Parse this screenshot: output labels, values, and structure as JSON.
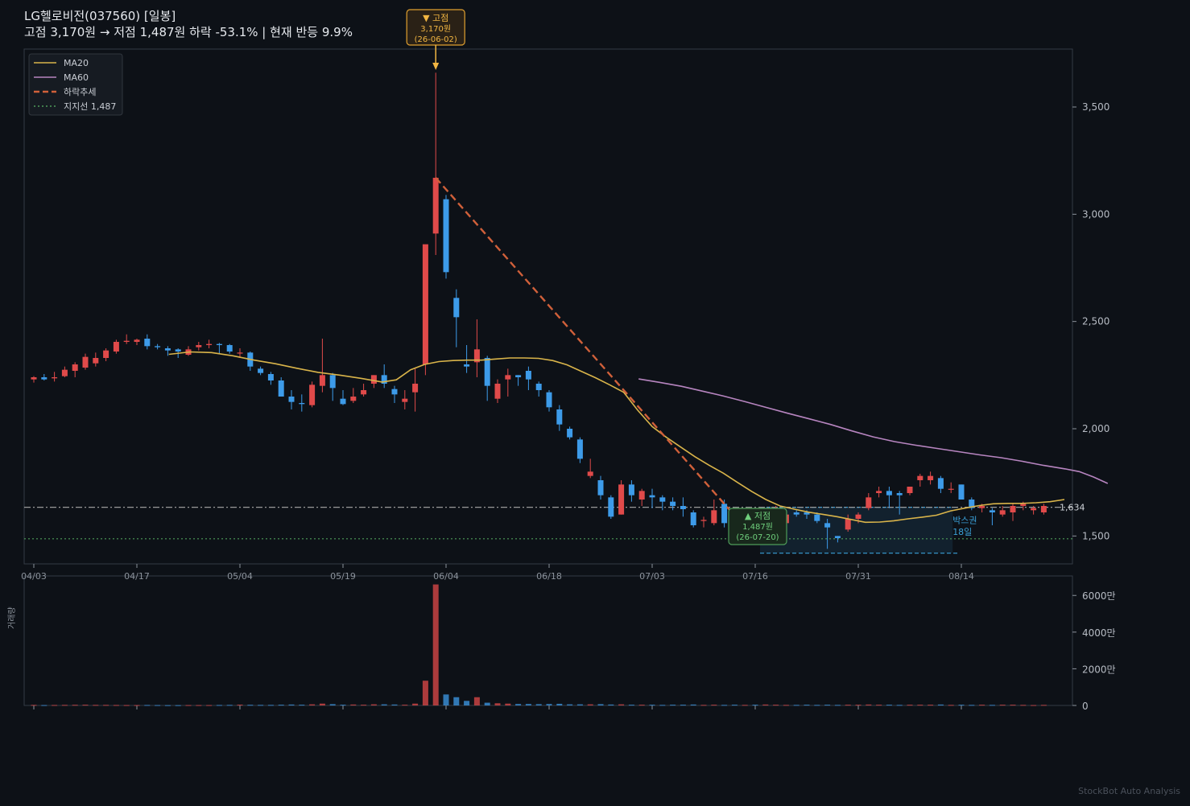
{
  "title": {
    "line1": "LG헬로비전(037560)  [일봉]",
    "line2": "고점 3,170원 → 저점 1,487원  하락 -53.1%  |  현재 반등 9.9%"
  },
  "watermark": "StockBot Auto Analysis",
  "colors": {
    "background": "#0d1117",
    "up": "#e04a4a",
    "down": "#3d9be9",
    "ma20": "#d9b44a",
    "ma60": "#b785c0",
    "trend": "#d0603a",
    "support": "#4e9d5a",
    "box": "#3aa0d8",
    "resistance": "#9a9a9a"
  },
  "chart_data": {
    "type": "candlestick",
    "xlabels": [
      "04/03",
      "04/17",
      "05/04",
      "05/19",
      "06/04",
      "06/18",
      "07/03",
      "07/16",
      "07/31",
      "08/14"
    ],
    "xlabel_indices": [
      0,
      10,
      20,
      30,
      40,
      50,
      60,
      70,
      80,
      90
    ],
    "ylim": [
      1370,
      3770
    ],
    "yticks": [
      1500,
      2000,
      2500,
      3000,
      3500
    ],
    "ytick_labels": [
      "1,500",
      "2,000",
      "2,500",
      "3,000",
      "3,500"
    ],
    "candles": [
      [
        2230,
        2245,
        2215,
        2240
      ],
      [
        2240,
        2255,
        2225,
        2230
      ],
      [
        2235,
        2265,
        2220,
        2240
      ],
      [
        2245,
        2290,
        2240,
        2275
      ],
      [
        2270,
        2310,
        2240,
        2300
      ],
      [
        2285,
        2350,
        2275,
        2335
      ],
      [
        2305,
        2355,
        2290,
        2330
      ],
      [
        2330,
        2375,
        2315,
        2365
      ],
      [
        2360,
        2415,
        2350,
        2405
      ],
      [
        2405,
        2440,
        2395,
        2410
      ],
      [
        2405,
        2420,
        2390,
        2415
      ],
      [
        2420,
        2440,
        2370,
        2385
      ],
      [
        2385,
        2395,
        2370,
        2380
      ],
      [
        2375,
        2385,
        2340,
        2365
      ],
      [
        2370,
        2375,
        2330,
        2360
      ],
      [
        2345,
        2385,
        2340,
        2370
      ],
      [
        2380,
        2405,
        2365,
        2390
      ],
      [
        2390,
        2415,
        2375,
        2395
      ],
      [
        2395,
        2400,
        2350,
        2390
      ],
      [
        2390,
        2395,
        2350,
        2360
      ],
      [
        2355,
        2375,
        2330,
        2355
      ],
      [
        2355,
        2360,
        2270,
        2290
      ],
      [
        2280,
        2290,
        2250,
        2260
      ],
      [
        2255,
        2265,
        2205,
        2225
      ],
      [
        2225,
        2240,
        2150,
        2150
      ],
      [
        2150,
        2180,
        2090,
        2125
      ],
      [
        2120,
        2160,
        2080,
        2115
      ],
      [
        2110,
        2220,
        2100,
        2205
      ],
      [
        2200,
        2420,
        2170,
        2250
      ],
      [
        2250,
        2260,
        2130,
        2190
      ],
      [
        2140,
        2180,
        2110,
        2115
      ],
      [
        2130,
        2190,
        2120,
        2150
      ],
      [
        2160,
        2210,
        2150,
        2180
      ],
      [
        2210,
        2250,
        2190,
        2250
      ],
      [
        2250,
        2300,
        2190,
        2210
      ],
      [
        2185,
        2200,
        2120,
        2160
      ],
      [
        2125,
        2180,
        2090,
        2140
      ],
      [
        2170,
        2280,
        2080,
        2210
      ],
      [
        2300,
        2500,
        2250,
        2860
      ],
      [
        2910,
        3660,
        2810,
        3170
      ],
      [
        3070,
        3090,
        2700,
        2730
      ],
      [
        2610,
        2650,
        2380,
        2520
      ],
      [
        2300,
        2390,
        2260,
        2290
      ],
      [
        2310,
        2510,
        2240,
        2370
      ],
      [
        2330,
        2340,
        2130,
        2200
      ],
      [
        2140,
        2230,
        2120,
        2210
      ],
      [
        2230,
        2280,
        2150,
        2250
      ],
      [
        2250,
        2250,
        2200,
        2240
      ],
      [
        2270,
        2290,
        2180,
        2230
      ],
      [
        2210,
        2220,
        2150,
        2180
      ],
      [
        2170,
        2180,
        2080,
        2100
      ],
      [
        2090,
        2110,
        1990,
        2020
      ],
      [
        2000,
        2010,
        1950,
        1960
      ],
      [
        1950,
        1960,
        1840,
        1860
      ],
      [
        1780,
        1860,
        1770,
        1800
      ],
      [
        1760,
        1780,
        1670,
        1690
      ],
      [
        1680,
        1690,
        1580,
        1590
      ],
      [
        1600,
        1760,
        1600,
        1740
      ],
      [
        1740,
        1760,
        1660,
        1690
      ],
      [
        1670,
        1720,
        1640,
        1710
      ],
      [
        1690,
        1720,
        1630,
        1680
      ],
      [
        1680,
        1690,
        1620,
        1660
      ],
      [
        1660,
        1680,
        1620,
        1640
      ],
      [
        1640,
        1680,
        1590,
        1625
      ],
      [
        1610,
        1620,
        1540,
        1550
      ],
      [
        1570,
        1590,
        1540,
        1575
      ],
      [
        1560,
        1670,
        1550,
        1620
      ],
      [
        1650,
        1670,
        1540,
        1560
      ],
      [
        1560,
        1580,
        1470,
        1520
      ],
      [
        1470,
        1560,
        1460,
        1520
      ],
      [
        1530,
        1550,
        1480,
        1490
      ],
      [
        1480,
        1600,
        1470,
        1590
      ],
      [
        1590,
        1640,
        1560,
        1620
      ],
      [
        1560,
        1600,
        1530,
        1600
      ],
      [
        1610,
        1620,
        1590,
        1600
      ],
      [
        1610,
        1620,
        1580,
        1600
      ],
      [
        1600,
        1610,
        1560,
        1570
      ],
      [
        1560,
        1580,
        1440,
        1540
      ],
      [
        1500,
        1500,
        1470,
        1490
      ],
      [
        1530,
        1600,
        1520,
        1580
      ],
      [
        1580,
        1610,
        1560,
        1600
      ],
      [
        1630,
        1700,
        1620,
        1680
      ],
      [
        1700,
        1730,
        1680,
        1710
      ],
      [
        1710,
        1730,
        1630,
        1690
      ],
      [
        1700,
        1710,
        1600,
        1690
      ],
      [
        1700,
        1730,
        1690,
        1730
      ],
      [
        1760,
        1790,
        1730,
        1780
      ],
      [
        1760,
        1800,
        1740,
        1780
      ],
      [
        1770,
        1780,
        1700,
        1720
      ],
      [
        1720,
        1750,
        1700,
        1720
      ],
      [
        1740,
        1740,
        1670,
        1670
      ],
      [
        1670,
        1680,
        1620,
        1630
      ],
      [
        1630,
        1650,
        1610,
        1640
      ],
      [
        1620,
        1630,
        1550,
        1610
      ],
      [
        1600,
        1640,
        1590,
        1620
      ],
      [
        1610,
        1650,
        1570,
        1640
      ],
      [
        1640,
        1660,
        1620,
        1650
      ],
      [
        1620,
        1640,
        1600,
        1630
      ],
      [
        1610,
        1650,
        1600,
        1640
      ]
    ],
    "ma20": [
      [
        19,
        2347
      ],
      [
        22,
        2358
      ],
      [
        25,
        2355
      ],
      [
        28,
        2340
      ],
      [
        31,
        2320
      ],
      [
        34,
        2303
      ],
      [
        37,
        2282
      ],
      [
        40,
        2263
      ],
      [
        43,
        2250
      ],
      [
        46,
        2235
      ],
      [
        49,
        2218
      ],
      [
        51,
        2228
      ],
      [
        53,
        2275
      ],
      [
        55,
        2300
      ],
      [
        57,
        2313
      ],
      [
        59,
        2318
      ],
      [
        61,
        2320
      ],
      [
        63,
        2320
      ],
      [
        65,
        2325
      ],
      [
        67,
        2330
      ],
      [
        69,
        2330
      ],
      [
        71,
        2328
      ],
      [
        73,
        2318
      ],
      [
        75,
        2298
      ],
      [
        77,
        2268
      ],
      [
        79,
        2238
      ],
      [
        81,
        2205
      ],
      [
        83,
        2170
      ],
      [
        85,
        2085
      ],
      [
        87,
        2010
      ],
      [
        89,
        1960
      ],
      [
        91,
        1915
      ],
      [
        93,
        1870
      ],
      [
        95,
        1830
      ],
      [
        97,
        1793
      ],
      [
        99,
        1750
      ],
      [
        101,
        1708
      ],
      [
        103,
        1670
      ],
      [
        105,
        1640
      ],
      [
        107,
        1625
      ],
      [
        109,
        1611
      ],
      [
        111,
        1601
      ],
      [
        113,
        1590
      ],
      [
        115,
        1577
      ],
      [
        117,
        1564
      ],
      [
        119,
        1565
      ],
      [
        121,
        1571
      ],
      [
        123,
        1580
      ],
      [
        125,
        1588
      ],
      [
        127,
        1597
      ],
      [
        129,
        1617
      ],
      [
        131,
        1630
      ],
      [
        133,
        1642
      ],
      [
        135,
        1650
      ],
      [
        137,
        1652
      ],
      [
        139,
        1652
      ],
      [
        141,
        1655
      ],
      [
        143,
        1660
      ],
      [
        145,
        1670
      ]
    ],
    "ma60_x0": 59,
    "ma60": [
      [
        59,
        2232
      ],
      [
        62,
        2216
      ],
      [
        65,
        2198
      ],
      [
        68,
        2175
      ],
      [
        71,
        2152
      ],
      [
        74,
        2126
      ],
      [
        77,
        2099
      ],
      [
        80,
        2072
      ],
      [
        83,
        2046
      ],
      [
        86,
        2020
      ],
      [
        89,
        1990
      ],
      [
        92,
        1962
      ],
      [
        95,
        1940
      ],
      [
        98,
        1923
      ],
      [
        101,
        1908
      ],
      [
        104,
        1893
      ],
      [
        107,
        1878
      ],
      [
        110,
        1865
      ],
      [
        113,
        1848
      ],
      [
        116,
        1829
      ],
      [
        119,
        1813
      ],
      [
        121,
        1800
      ],
      [
        123,
        1775
      ],
      [
        125,
        1745
      ]
    ],
    "volume": [
      30,
      20,
      25,
      30,
      35,
      40,
      30,
      30,
      25,
      20,
      20,
      25,
      20,
      15,
      15,
      20,
      20,
      20,
      25,
      30,
      45,
      35,
      30,
      30,
      40,
      50,
      40,
      60,
      100,
      70,
      40,
      50,
      40,
      60,
      60,
      50,
      40,
      100,
      1350,
      6600,
      600,
      450,
      250,
      450,
      150,
      120,
      100,
      80,
      80,
      70,
      80,
      90,
      60,
      60,
      60,
      70,
      50,
      60,
      40,
      40,
      40,
      30,
      40,
      40,
      50,
      30,
      40,
      30,
      40,
      30,
      40,
      50,
      40,
      30,
      30,
      40,
      30,
      40,
      30,
      40,
      40,
      50,
      40,
      40,
      30,
      40,
      40,
      40,
      50,
      30,
      40,
      30,
      40,
      30,
      40,
      40,
      30,
      20,
      30
    ],
    "vol_yticks": [
      0,
      2000,
      4000,
      6000
    ],
    "vol_ytick_labels": [
      "0",
      "2000만",
      "4000만",
      "6000만"
    ],
    "vol_ymax": 6800,
    "vol_ylabel": "거래량",
    "legend": [
      "MA20",
      "MA60",
      "하락추세",
      "지지선 1,487"
    ],
    "legend_placement": "top-left",
    "trend_line": {
      "from": [
        39,
        3170
      ],
      "to": [
        70,
        1487
      ]
    },
    "support": 1487,
    "resistance": 1634,
    "resistance_label": "1,634",
    "box": {
      "x_start": 70,
      "x_end": 89,
      "y_low": 1420,
      "y_high": 1634,
      "label1": "박스권",
      "label2": "18일"
    },
    "peak": {
      "index": 39,
      "price": 3170,
      "title": "▼ 고점",
      "price_label": "3,170원",
      "date": "(26-06-02)"
    },
    "trough": {
      "index": 70,
      "price": 1487,
      "title": "▲ 저점",
      "price_label": "1,487원",
      "date": "(26-07-20)"
    }
  }
}
